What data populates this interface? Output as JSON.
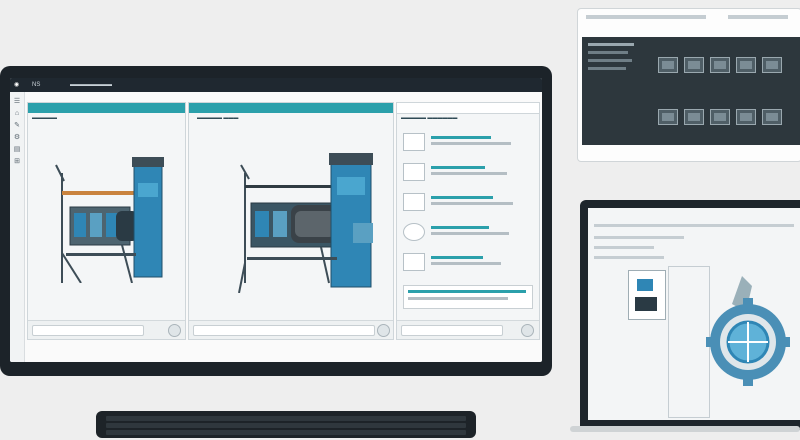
{
  "app": {
    "topbar": {
      "logo": "◉",
      "label_1": "NS",
      "label_2": "▬▬▬▬",
      "label_3": "▬▬▬"
    },
    "left_rail_icons": [
      "☰",
      "⌂",
      "✎",
      "⚙",
      "▤",
      "⊞"
    ],
    "panels": [
      {
        "sub_label": "▬▬▬▬▬"
      },
      {
        "sub_label": "▬▬▬▬▬  ▬▬▬"
      },
      {
        "sub_label": "▬▬▬▬▬ ▬▬▬▬▬▬"
      }
    ]
  },
  "colors": {
    "accent": "#2ba0ab",
    "monitor_bezel": "#1c2329",
    "machine_blue": "#2f86b5",
    "machine_dark": "#2a3a44"
  },
  "icons": {
    "list_thumbs": [
      "document-icon",
      "document-icon",
      "document-icon",
      "gear-icon",
      "document-icon"
    ],
    "gear_badge": "gear-icon"
  }
}
